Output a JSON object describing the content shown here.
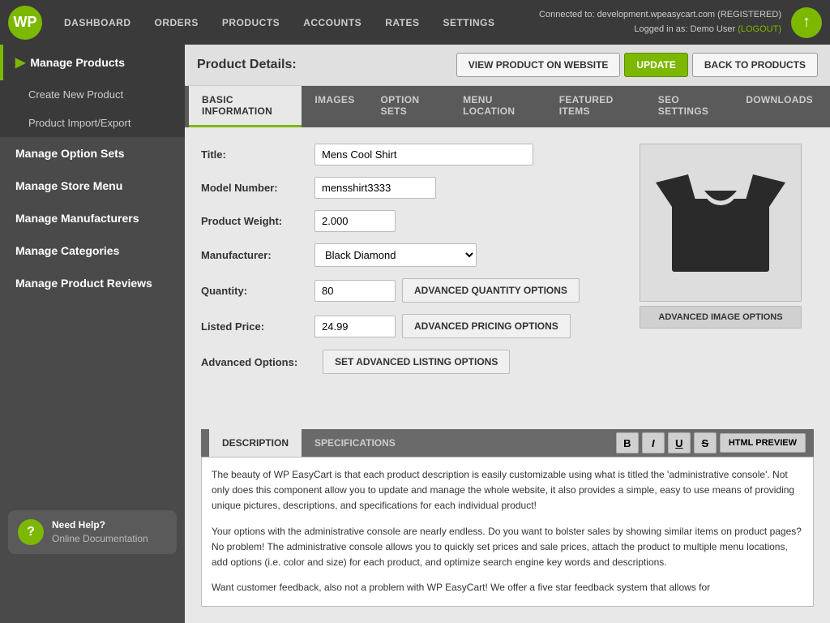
{
  "site": {
    "connected_to": "Connected to: development.wpeasycart.com",
    "status": "(REGISTERED)",
    "logged_in": "Logged in as: Demo User",
    "logout": "(LOGOUT)"
  },
  "logo": {
    "text": "WP"
  },
  "nav": {
    "items": [
      {
        "id": "dashboard",
        "label": "DASHBOARD"
      },
      {
        "id": "orders",
        "label": "ORDERS"
      },
      {
        "id": "products",
        "label": "PRODUCTS"
      },
      {
        "id": "accounts",
        "label": "ACCOUNTS"
      },
      {
        "id": "rates",
        "label": "RATES"
      },
      {
        "id": "settings",
        "label": "SETTINGS"
      }
    ]
  },
  "sidebar": {
    "sections": [
      {
        "id": "manage-products",
        "label": "Manage Products",
        "active": true,
        "sub": [
          {
            "id": "create-new-product",
            "label": "Create New Product"
          },
          {
            "id": "product-import-export",
            "label": "Product Import/Export"
          }
        ]
      },
      {
        "id": "manage-option-sets",
        "label": "Manage Option Sets",
        "active": false
      },
      {
        "id": "manage-store-menu",
        "label": "Manage Store Menu",
        "active": false
      },
      {
        "id": "manage-manufacturers",
        "label": "Manage Manufacturers",
        "active": false
      },
      {
        "id": "manage-categories",
        "label": "Manage Categories",
        "active": false
      },
      {
        "id": "manage-product-reviews",
        "label": "Manage Product Reviews",
        "active": false
      }
    ]
  },
  "help": {
    "title": "Need Help?",
    "subtitle": "Online Documentation",
    "icon": "?"
  },
  "product_header": {
    "title": "Product Details:",
    "buttons": {
      "view": "VIEW PRODUCT ON WEBSITE",
      "update": "UPDATE",
      "back": "BACK TO PRODUCTS"
    }
  },
  "tabs": [
    {
      "id": "basic-information",
      "label": "BASIC INFORMATION",
      "active": true
    },
    {
      "id": "images",
      "label": "IMAGES",
      "active": false
    },
    {
      "id": "option-sets",
      "label": "OPTION SETS",
      "active": false
    },
    {
      "id": "menu-location",
      "label": "MENU LOCATION",
      "active": false
    },
    {
      "id": "featured-items",
      "label": "FEATURED ITEMS",
      "active": false
    },
    {
      "id": "seo-settings",
      "label": "SEO SETTINGS",
      "active": false
    },
    {
      "id": "downloads",
      "label": "DOWNLOADS",
      "active": false
    }
  ],
  "form": {
    "title_label": "Title:",
    "title_value": "Mens Cool Shirt",
    "model_label": "Model Number:",
    "model_value": "mensshirt3333",
    "weight_label": "Product Weight:",
    "weight_value": "2.000",
    "manufacturer_label": "Manufacturer:",
    "manufacturer_value": "Black Diamond",
    "quantity_label": "Quantity:",
    "quantity_value": "80",
    "price_label": "Listed Price:",
    "price_value": "24.99",
    "advanced_options_label": "Advanced Options:",
    "advanced_quantity_btn": "ADVANCED QUANTITY OPTIONS",
    "advanced_pricing_btn": "ADVANCED PRICING OPTIONS",
    "advanced_listing_btn": "SET ADVANCED LISTING OPTIONS",
    "advanced_image_btn": "ADVANCED IMAGE OPTIONS"
  },
  "description": {
    "tabs": [
      {
        "id": "description",
        "label": "DESCRIPTION",
        "active": true
      },
      {
        "id": "specifications",
        "label": "SPECIFICATIONS",
        "active": false
      }
    ],
    "editor_buttons": [
      {
        "id": "bold",
        "label": "B",
        "title": "Bold"
      },
      {
        "id": "italic",
        "label": "I",
        "title": "Italic"
      },
      {
        "id": "underline",
        "label": "U",
        "title": "Underline"
      },
      {
        "id": "strikethrough",
        "label": "S",
        "title": "Strikethrough"
      }
    ],
    "html_preview_label": "HTML PREVIEW",
    "content_paragraphs": [
      "The beauty of WP EasyCart is that each product description is easily customizable using what is titled the 'administrative console'. Not only does this component allow you to update and manage the whole website, it also provides a simple, easy to use means of providing unique pictures, descriptions, and specifications for each individual product!",
      "Your options with the administrative console are nearly endless. Do you want to bolster sales by showing similar items on product pages? No problem! The administrative console allows you to quickly set prices and sale prices, attach the product to multiple menu locations, add options (i.e. color and size) for each product, and optimize search engine key words and descriptions.",
      "Want customer feedback, also not a problem with WP EasyCart! We offer a five star feedback system that allows for"
    ]
  }
}
